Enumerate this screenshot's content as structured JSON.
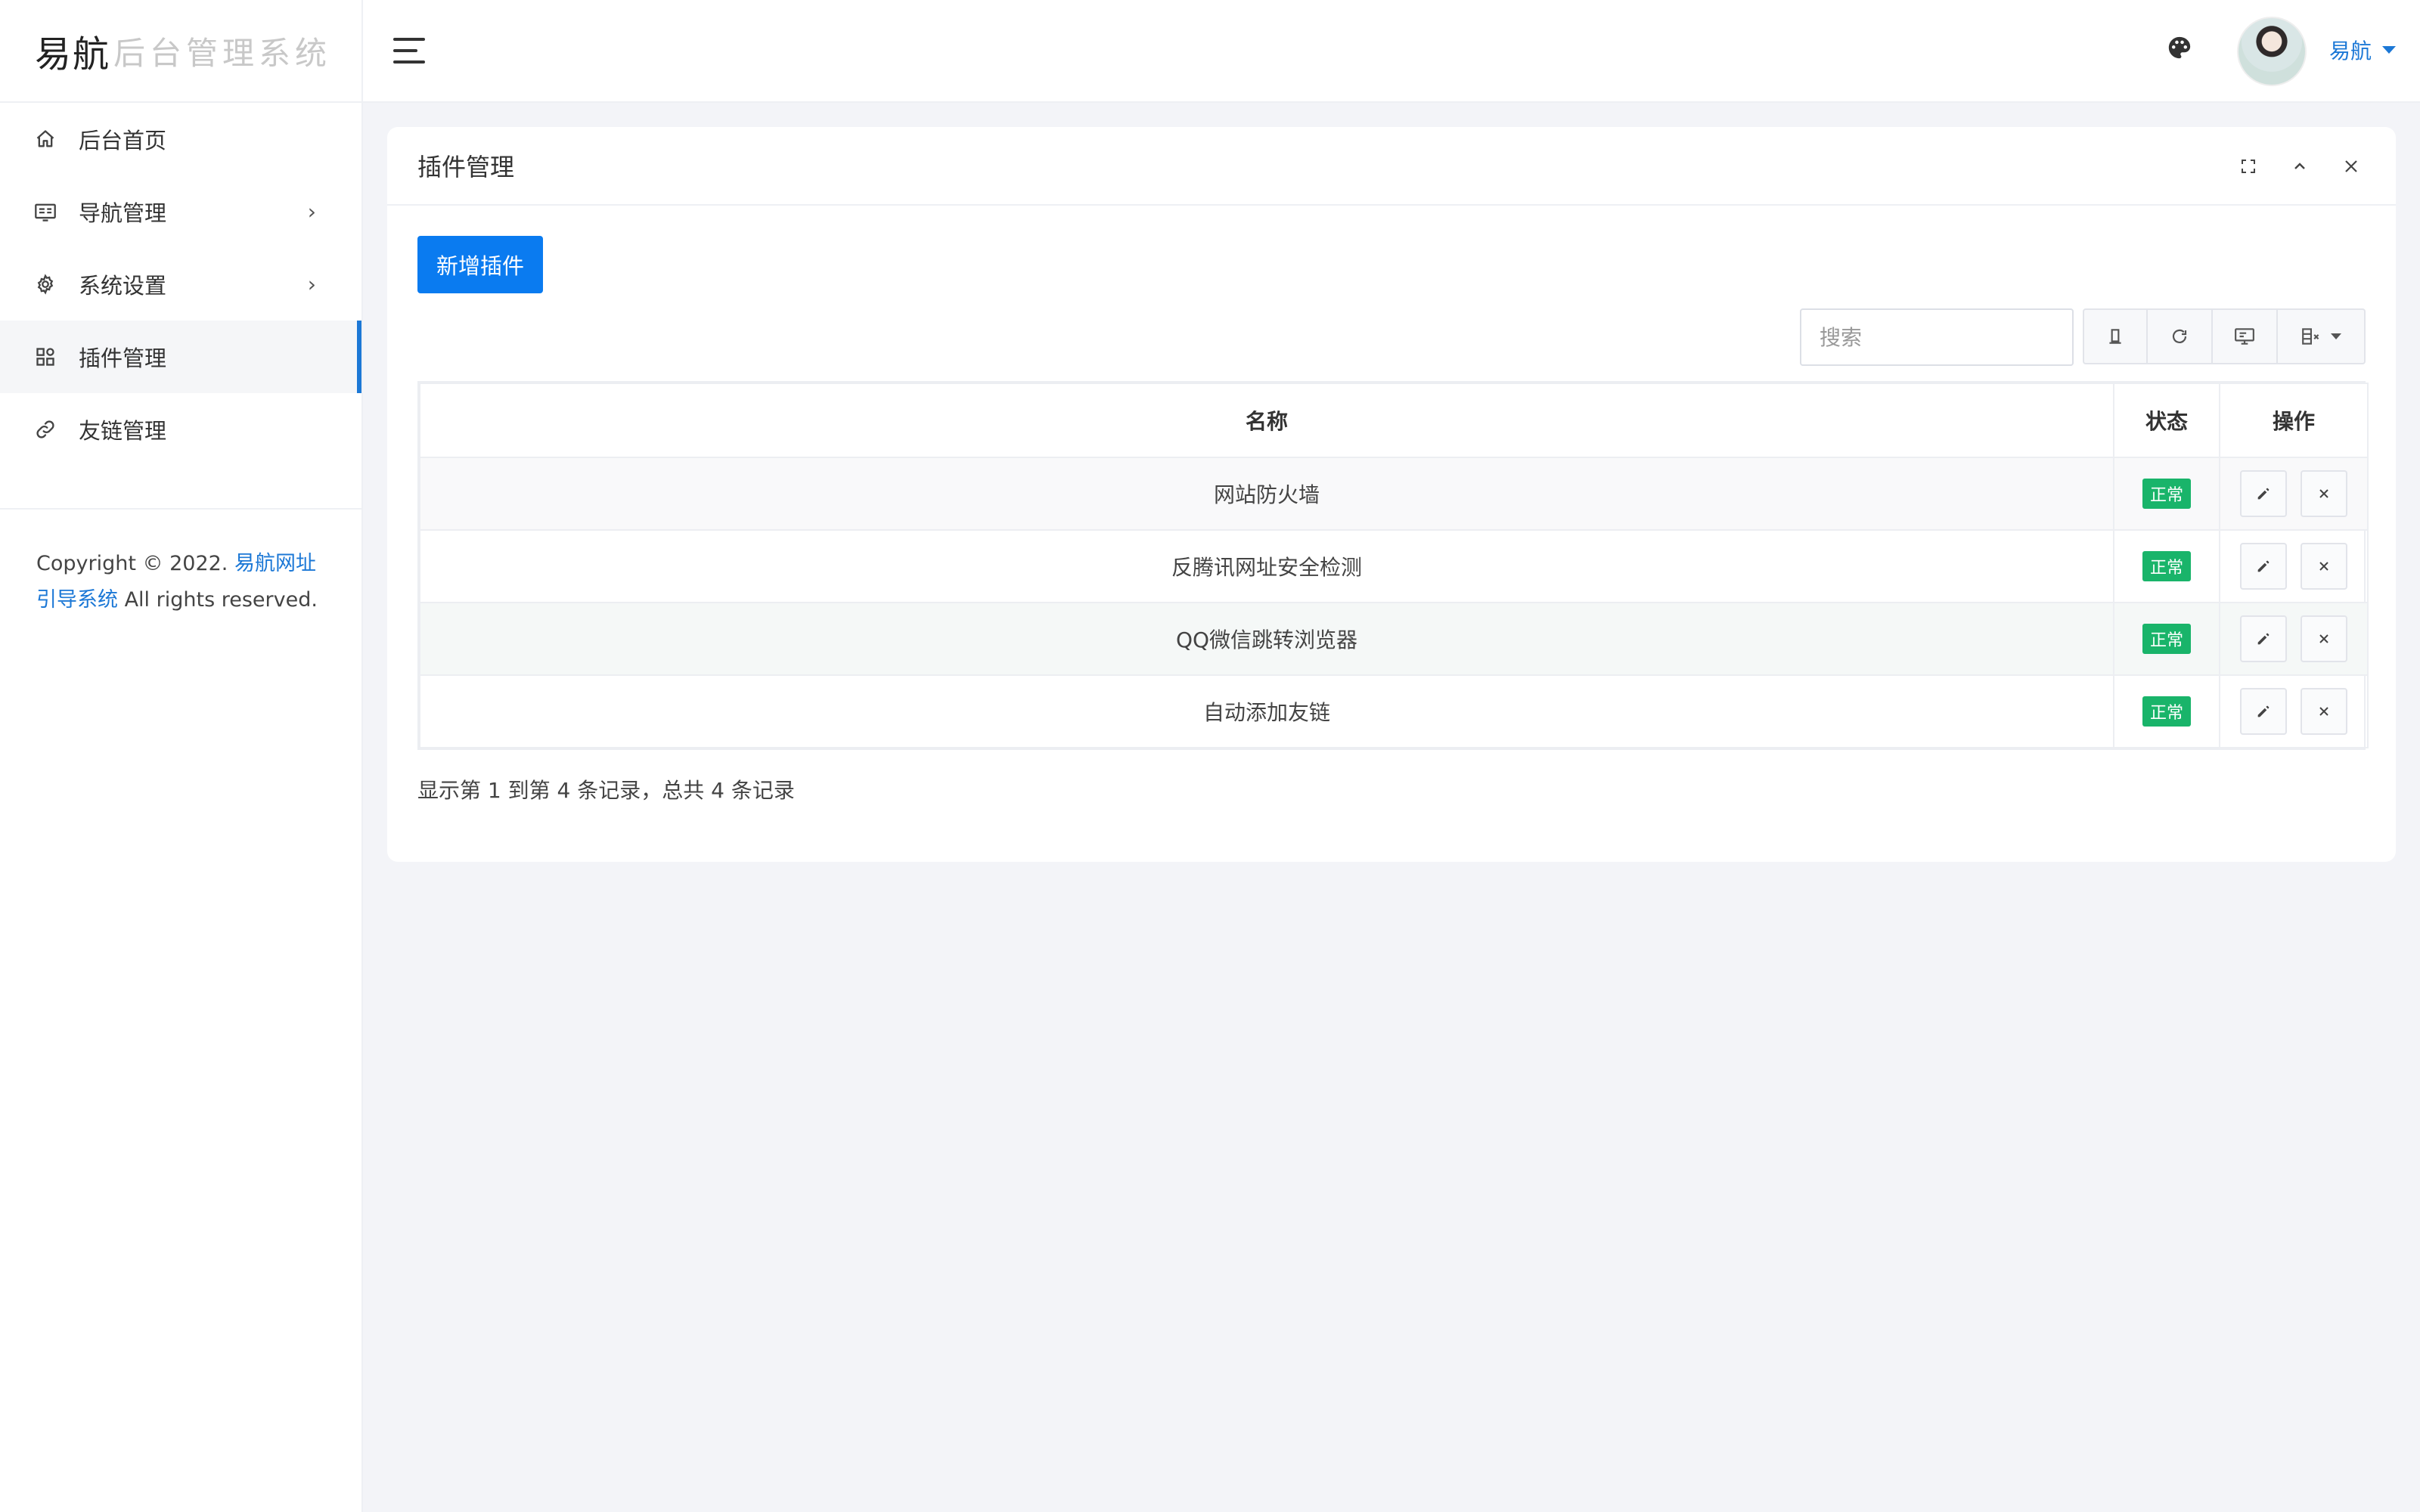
{
  "brand": {
    "main": "易航",
    "sub": "后台管理系统"
  },
  "sidebar": {
    "items": [
      {
        "label": "后台首页",
        "icon": "home-icon",
        "has_arrow": false,
        "active": false
      },
      {
        "label": "导航管理",
        "icon": "navigation-icon",
        "has_arrow": true,
        "active": false
      },
      {
        "label": "系统设置",
        "icon": "gear-icon",
        "has_arrow": true,
        "active": false
      },
      {
        "label": "插件管理",
        "icon": "grid-icon",
        "has_arrow": false,
        "active": true
      },
      {
        "label": "友链管理",
        "icon": "link-icon",
        "has_arrow": false,
        "active": false
      }
    ],
    "arrow": "›",
    "copyright": {
      "prefix": "Copyright © 2022. ",
      "link_text": "易航网址引导系统",
      "suffix": " All rights reserved."
    }
  },
  "header": {
    "user_name": "易航"
  },
  "card": {
    "title": "插件管理",
    "add_button": "新增插件",
    "search_placeholder": "搜索"
  },
  "table": {
    "columns": [
      "名称",
      "状态",
      "操作"
    ],
    "rows": [
      {
        "name": "网站防火墙",
        "status": "正常"
      },
      {
        "name": "反腾讯网址安全检测",
        "status": "正常"
      },
      {
        "name": "QQ微信跳转浏览器",
        "status": "正常"
      },
      {
        "name": "自动添加友链",
        "status": "正常"
      }
    ]
  },
  "pagination": {
    "info": "显示第 1 到第 4 条记录，总共 4 条记录"
  },
  "colors": {
    "primary": "#0a7bf0",
    "link": "#1c78d6",
    "success": "#19b46a",
    "background": "#f3f4f8"
  }
}
